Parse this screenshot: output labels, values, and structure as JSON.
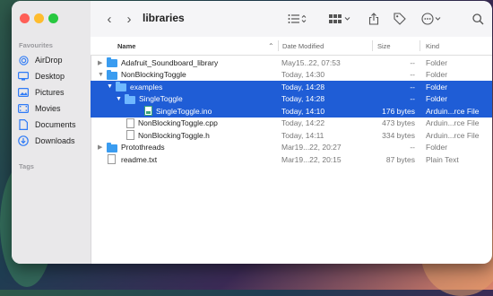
{
  "window": {
    "title": "libraries"
  },
  "colors": {
    "accent": "#1f5dd6",
    "folder": "#3a9cf0",
    "sidebar_icon": "#2f7bf6"
  },
  "sidebar": {
    "favourites_heading": "Favourites",
    "items": [
      {
        "label": "AirDrop",
        "icon": "airdrop-icon"
      },
      {
        "label": "Desktop",
        "icon": "desktop-icon"
      },
      {
        "label": "Pictures",
        "icon": "pictures-icon"
      },
      {
        "label": "Movies",
        "icon": "movies-icon"
      },
      {
        "label": "Documents",
        "icon": "documents-icon"
      },
      {
        "label": "Downloads",
        "icon": "downloads-icon"
      }
    ],
    "tags_heading": "Tags"
  },
  "columns": {
    "name": "Name",
    "date": "Date Modified",
    "size": "Size",
    "kind": "Kind"
  },
  "rows": [
    {
      "name": "Adafruit_Soundboard_library",
      "date": "May15..22, 07:53",
      "size": "--",
      "kind": "Folder"
    },
    {
      "name": "NonBlockingToggle",
      "date": "Today, 14:30",
      "size": "--",
      "kind": "Folder"
    },
    {
      "name": "examples",
      "date": "Today, 14:28",
      "size": "--",
      "kind": "Folder"
    },
    {
      "name": "SingleToggle",
      "date": "Today, 14:28",
      "size": "--",
      "kind": "Folder"
    },
    {
      "name": "SingleToggle.ino",
      "date": "Today, 14:10",
      "size": "176 bytes",
      "kind": "Arduin...rce File"
    },
    {
      "name": "NonBlockingToggle.cpp",
      "date": "Today, 14:22",
      "size": "473 bytes",
      "kind": "Arduin...rce File"
    },
    {
      "name": "NonBlockingToggle.h",
      "date": "Today, 14:11",
      "size": "334 bytes",
      "kind": "Arduin...rce File"
    },
    {
      "name": "Protothreads",
      "date": "Mar19...22, 20:27",
      "size": "--",
      "kind": "Folder"
    },
    {
      "name": "readme.txt",
      "date": "Mar19...22, 20:15",
      "size": "87 bytes",
      "kind": "Plain Text"
    }
  ]
}
